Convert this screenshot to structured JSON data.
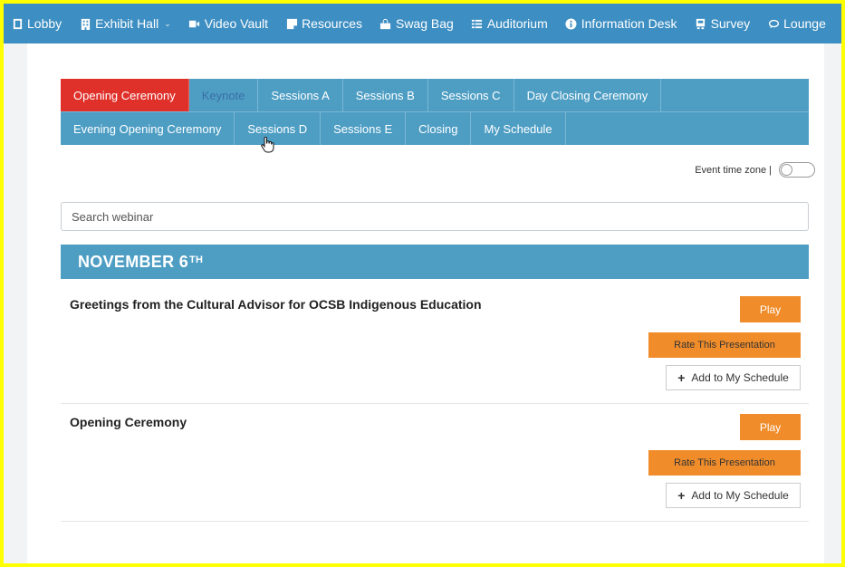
{
  "nav": {
    "items": [
      {
        "label": "Lobby",
        "icon": "door-icon"
      },
      {
        "label": "Exhibit Hall",
        "icon": "building-icon",
        "has_dropdown": true
      },
      {
        "label": "Video Vault",
        "icon": "video-camera-icon"
      },
      {
        "label": "Resources",
        "icon": "note-icon"
      },
      {
        "label": "Swag Bag",
        "icon": "shopping-bag-icon"
      },
      {
        "label": "Auditorium",
        "icon": "list-icon"
      },
      {
        "label": "Information Desk",
        "icon": "info-circle-icon"
      },
      {
        "label": "Survey",
        "icon": "survey-icon"
      },
      {
        "label": "Lounge",
        "icon": "chat-icon"
      }
    ],
    "color": "#3d8ec2"
  },
  "tabs": {
    "row1": [
      "Opening Ceremony",
      "Keynote",
      "Sessions A",
      "Sessions B",
      "Sessions C",
      "Day Closing Ceremony"
    ],
    "row2": [
      "Evening Opening Ceremony",
      "Sessions D",
      "Sessions E",
      "Closing",
      "My Schedule"
    ],
    "active": "Opening Ceremony",
    "active_color": "#e0302a",
    "bar_color": "#4e9ec4"
  },
  "timezone": {
    "label": "Event time zone |",
    "enabled": false
  },
  "search": {
    "placeholder": "Search webinar"
  },
  "date_heading": {
    "text": "NOVEMBER 6",
    "suffix": "TH"
  },
  "sessions": [
    {
      "title": "Greetings from the Cultural Advisor for OCSB Indigenous Education",
      "play_label": "Play",
      "rate_label": "Rate This Presentation",
      "add_label": "Add to My Schedule"
    },
    {
      "title": "Opening Ceremony",
      "play_label": "Play",
      "rate_label": "Rate This Presentation",
      "add_label": "Add to My Schedule"
    }
  ],
  "button_color": "#f08c2a"
}
